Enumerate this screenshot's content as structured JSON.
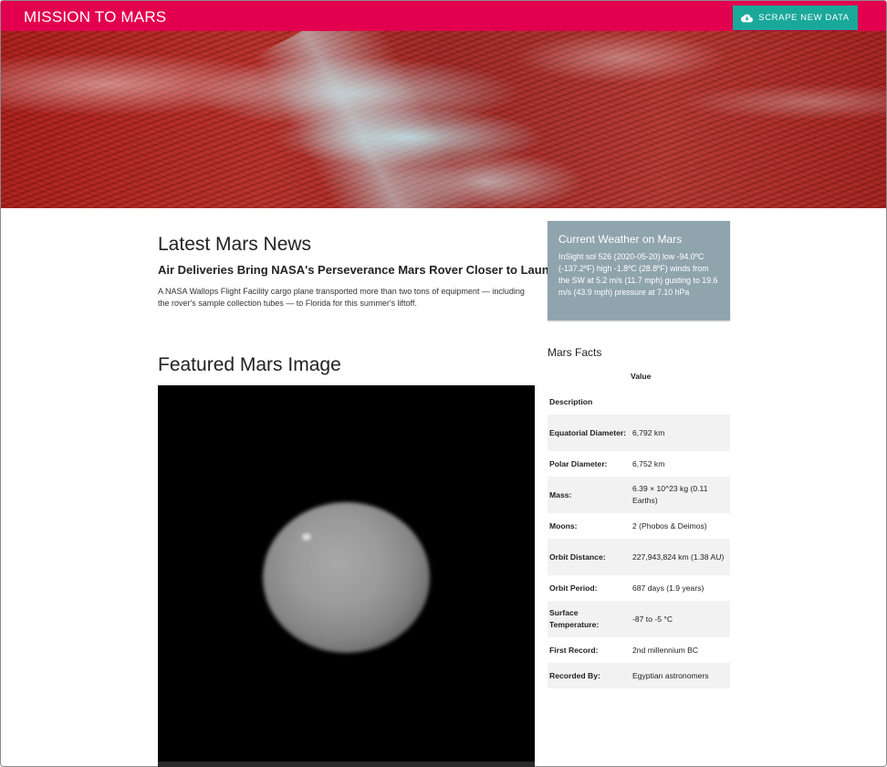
{
  "navbar": {
    "brand": "MISSION TO MARS",
    "scrape_button": "SCRAPE NEW DATA",
    "scrape_icon": "cloud-download-icon"
  },
  "news": {
    "section_title": "Latest Mars News",
    "headline": "Air Deliveries Bring NASA's Perseverance Mars Rover Closer to Launch",
    "teaser": "A NASA Wallops Flight Facility cargo plane transported more than two tons of equipment — including the rover's sample collection tubes — to Florida for this summer's liftoff."
  },
  "weather": {
    "title": "Current Weather on Mars",
    "text": "InSight sol 526 (2020-05-20) low -94.0ºC (-137.2ºF) high -1.8ºC (28.8ºF) winds from the SW at 5.2 m/s (11.7 mph) gusting to 19.6 m/s (43.9 mph) pressure at 7.10 hPa"
  },
  "featured": {
    "title": "Featured Mars Image"
  },
  "facts": {
    "title": "Mars Facts",
    "value_header": "Value",
    "description_header": "Description",
    "rows": [
      {
        "label": "Equatorial Diameter:",
        "value": "6,792 km"
      },
      {
        "label": "Polar Diameter:",
        "value": "6,752 km"
      },
      {
        "label": "Mass:",
        "value": "6.39 × 10^23 kg (0.11 Earths)"
      },
      {
        "label": "Moons:",
        "value": "2 (Phobos & Deimos)"
      },
      {
        "label": "Orbit Distance:",
        "value": "227,943,824 km (1.38 AU)"
      },
      {
        "label": "Orbit Period:",
        "value": "687 days (1.9 years)"
      },
      {
        "label": "Surface Temperature:",
        "value": "-87 to -5 °C"
      },
      {
        "label": "First Record:",
        "value": "2nd millennium BC"
      },
      {
        "label": "Recorded By:",
        "value": "Egyptian astronomers"
      }
    ]
  },
  "colors": {
    "navbar": "#e2004e",
    "button": "#1aa89a",
    "weather_card": "#90a4ae"
  }
}
